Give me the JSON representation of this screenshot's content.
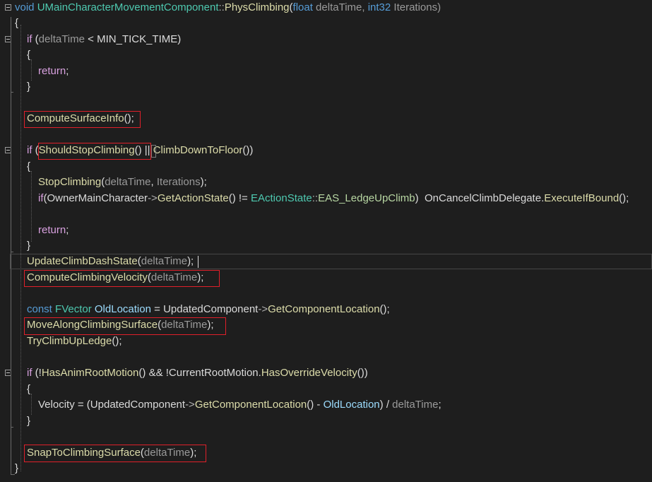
{
  "editor": {
    "lines": [
      {
        "id": "l1",
        "tokens": [
          {
            "t": "void",
            "c": "kw"
          },
          {
            "t": " ",
            "c": ""
          },
          {
            "t": "UMainCharacterMovementComponent",
            "c": "type"
          },
          {
            "t": "::",
            "c": "op"
          },
          {
            "t": "PhysClimbing",
            "c": "fn"
          },
          {
            "t": "(",
            "c": ""
          },
          {
            "t": "float",
            "c": "kw"
          },
          {
            "t": " deltaTime, ",
            "c": "param"
          },
          {
            "t": "int32",
            "c": "kw"
          },
          {
            "t": " Iterations)",
            "c": "param"
          }
        ]
      },
      {
        "id": "l2",
        "tokens": [
          {
            "t": "{",
            "c": ""
          }
        ]
      },
      {
        "id": "l3",
        "tokens": [
          {
            "t": "if",
            "c": "ctl"
          },
          {
            "t": " (",
            "c": ""
          },
          {
            "t": "deltaTime",
            "c": "param"
          },
          {
            "t": " < MIN_TICK_TIME)",
            "c": ""
          }
        ]
      },
      {
        "id": "l4",
        "tokens": [
          {
            "t": "{",
            "c": ""
          }
        ]
      },
      {
        "id": "l5",
        "tokens": [
          {
            "t": "return",
            "c": "ctl"
          },
          {
            "t": ";",
            "c": ""
          }
        ]
      },
      {
        "id": "l6",
        "tokens": [
          {
            "t": "}",
            "c": ""
          }
        ]
      },
      {
        "id": "l7",
        "tokens": []
      },
      {
        "id": "l8",
        "tokens": [
          {
            "t": "ComputeSurfaceInfo",
            "c": "fn"
          },
          {
            "t": "();",
            "c": ""
          }
        ]
      },
      {
        "id": "l9",
        "tokens": []
      },
      {
        "id": "l10",
        "tokens": [
          {
            "t": "if",
            "c": "ctl"
          },
          {
            "t": " (",
            "c": ""
          },
          {
            "t": "ShouldStopClimbing",
            "c": "fn"
          },
          {
            "t": "() || ",
            "c": ""
          },
          {
            "t": "ClimbDownToFloor",
            "c": "fn"
          },
          {
            "t": "())",
            "c": ""
          }
        ]
      },
      {
        "id": "l11",
        "tokens": [
          {
            "t": "{",
            "c": ""
          }
        ]
      },
      {
        "id": "l12",
        "tokens": [
          {
            "t": "StopClimbing",
            "c": "fn"
          },
          {
            "t": "(",
            "c": ""
          },
          {
            "t": "deltaTime",
            "c": "param"
          },
          {
            "t": ", ",
            "c": ""
          },
          {
            "t": "Iterations",
            "c": "param"
          },
          {
            "t": ");",
            "c": ""
          }
        ]
      },
      {
        "id": "l13",
        "tokens": [
          {
            "t": "if",
            "c": "ctl"
          },
          {
            "t": "(",
            "c": ""
          },
          {
            "t": "OwnerMainCharacter",
            "c": "member"
          },
          {
            "t": "->",
            "c": "op"
          },
          {
            "t": "GetActionState",
            "c": "fn"
          },
          {
            "t": "() != ",
            "c": ""
          },
          {
            "t": "EActionState",
            "c": "type"
          },
          {
            "t": "::",
            "c": "op"
          },
          {
            "t": "EAS_LedgeUpClimb",
            "c": "enum"
          },
          {
            "t": ")  ",
            "c": ""
          },
          {
            "t": "OnCancelClimbDelegate",
            "c": "member"
          },
          {
            "t": ".",
            "c": ""
          },
          {
            "t": "ExecuteIfBound",
            "c": "fn"
          },
          {
            "t": "();",
            "c": ""
          }
        ]
      },
      {
        "id": "l14",
        "tokens": []
      },
      {
        "id": "l15",
        "tokens": [
          {
            "t": "return",
            "c": "ctl"
          },
          {
            "t": ";",
            "c": ""
          }
        ]
      },
      {
        "id": "l16",
        "tokens": [
          {
            "t": "}",
            "c": ""
          }
        ]
      },
      {
        "id": "l17",
        "tokens": [
          {
            "t": "UpdateClimbDashState",
            "c": "fn"
          },
          {
            "t": "(",
            "c": ""
          },
          {
            "t": "deltaTime",
            "c": "param"
          },
          {
            "t": ");",
            "c": ""
          }
        ]
      },
      {
        "id": "l18",
        "tokens": [
          {
            "t": "ComputeClimbingVelocity",
            "c": "fn"
          },
          {
            "t": "(",
            "c": ""
          },
          {
            "t": "deltaTime",
            "c": "param"
          },
          {
            "t": ");",
            "c": ""
          }
        ]
      },
      {
        "id": "l19",
        "tokens": []
      },
      {
        "id": "l20",
        "tokens": [
          {
            "t": "const",
            "c": "kw"
          },
          {
            "t": " ",
            "c": ""
          },
          {
            "t": "FVector",
            "c": "type"
          },
          {
            "t": " ",
            "c": ""
          },
          {
            "t": "OldLocation",
            "c": "var"
          },
          {
            "t": " = ",
            "c": ""
          },
          {
            "t": "UpdatedComponent",
            "c": "member"
          },
          {
            "t": "->",
            "c": "op"
          },
          {
            "t": "GetComponentLocation",
            "c": "fn"
          },
          {
            "t": "();",
            "c": ""
          }
        ]
      },
      {
        "id": "l21",
        "tokens": [
          {
            "t": "MoveAlongClimbingSurface",
            "c": "fn"
          },
          {
            "t": "(",
            "c": ""
          },
          {
            "t": "deltaTime",
            "c": "param"
          },
          {
            "t": ");",
            "c": ""
          }
        ]
      },
      {
        "id": "l22",
        "tokens": [
          {
            "t": "TryClimbUpLedge",
            "c": "fn"
          },
          {
            "t": "();",
            "c": ""
          }
        ]
      },
      {
        "id": "l23",
        "tokens": []
      },
      {
        "id": "l24",
        "tokens": [
          {
            "t": "if",
            "c": "ctl"
          },
          {
            "t": " (!",
            "c": ""
          },
          {
            "t": "HasAnimRootMotion",
            "c": "fn"
          },
          {
            "t": "() && !",
            "c": ""
          },
          {
            "t": "CurrentRootMotion",
            "c": "member"
          },
          {
            "t": ".",
            "c": ""
          },
          {
            "t": "HasOverrideVelocity",
            "c": "fn"
          },
          {
            "t": "())",
            "c": ""
          }
        ]
      },
      {
        "id": "l25",
        "tokens": [
          {
            "t": "{",
            "c": ""
          }
        ]
      },
      {
        "id": "l26",
        "tokens": [
          {
            "t": "Velocity",
            "c": "member"
          },
          {
            "t": " = (",
            "c": ""
          },
          {
            "t": "UpdatedComponent",
            "c": "member"
          },
          {
            "t": "->",
            "c": "op"
          },
          {
            "t": "GetComponentLocation",
            "c": "fn"
          },
          {
            "t": "() - ",
            "c": ""
          },
          {
            "t": "OldLocation",
            "c": "var"
          },
          {
            "t": ") / ",
            "c": ""
          },
          {
            "t": "deltaTime",
            "c": "param"
          },
          {
            "t": ";",
            "c": ""
          }
        ]
      },
      {
        "id": "l27",
        "tokens": [
          {
            "t": "}",
            "c": ""
          }
        ]
      },
      {
        "id": "l28",
        "tokens": []
      },
      {
        "id": "l29",
        "tokens": [
          {
            "t": "SnapToClimbingSurface",
            "c": "fn"
          },
          {
            "t": "(",
            "c": ""
          },
          {
            "t": "deltaTime",
            "c": "param"
          },
          {
            "t": ");",
            "c": ""
          }
        ]
      },
      {
        "id": "l30",
        "tokens": [
          {
            "t": "}",
            "c": ""
          }
        ]
      }
    ]
  }
}
